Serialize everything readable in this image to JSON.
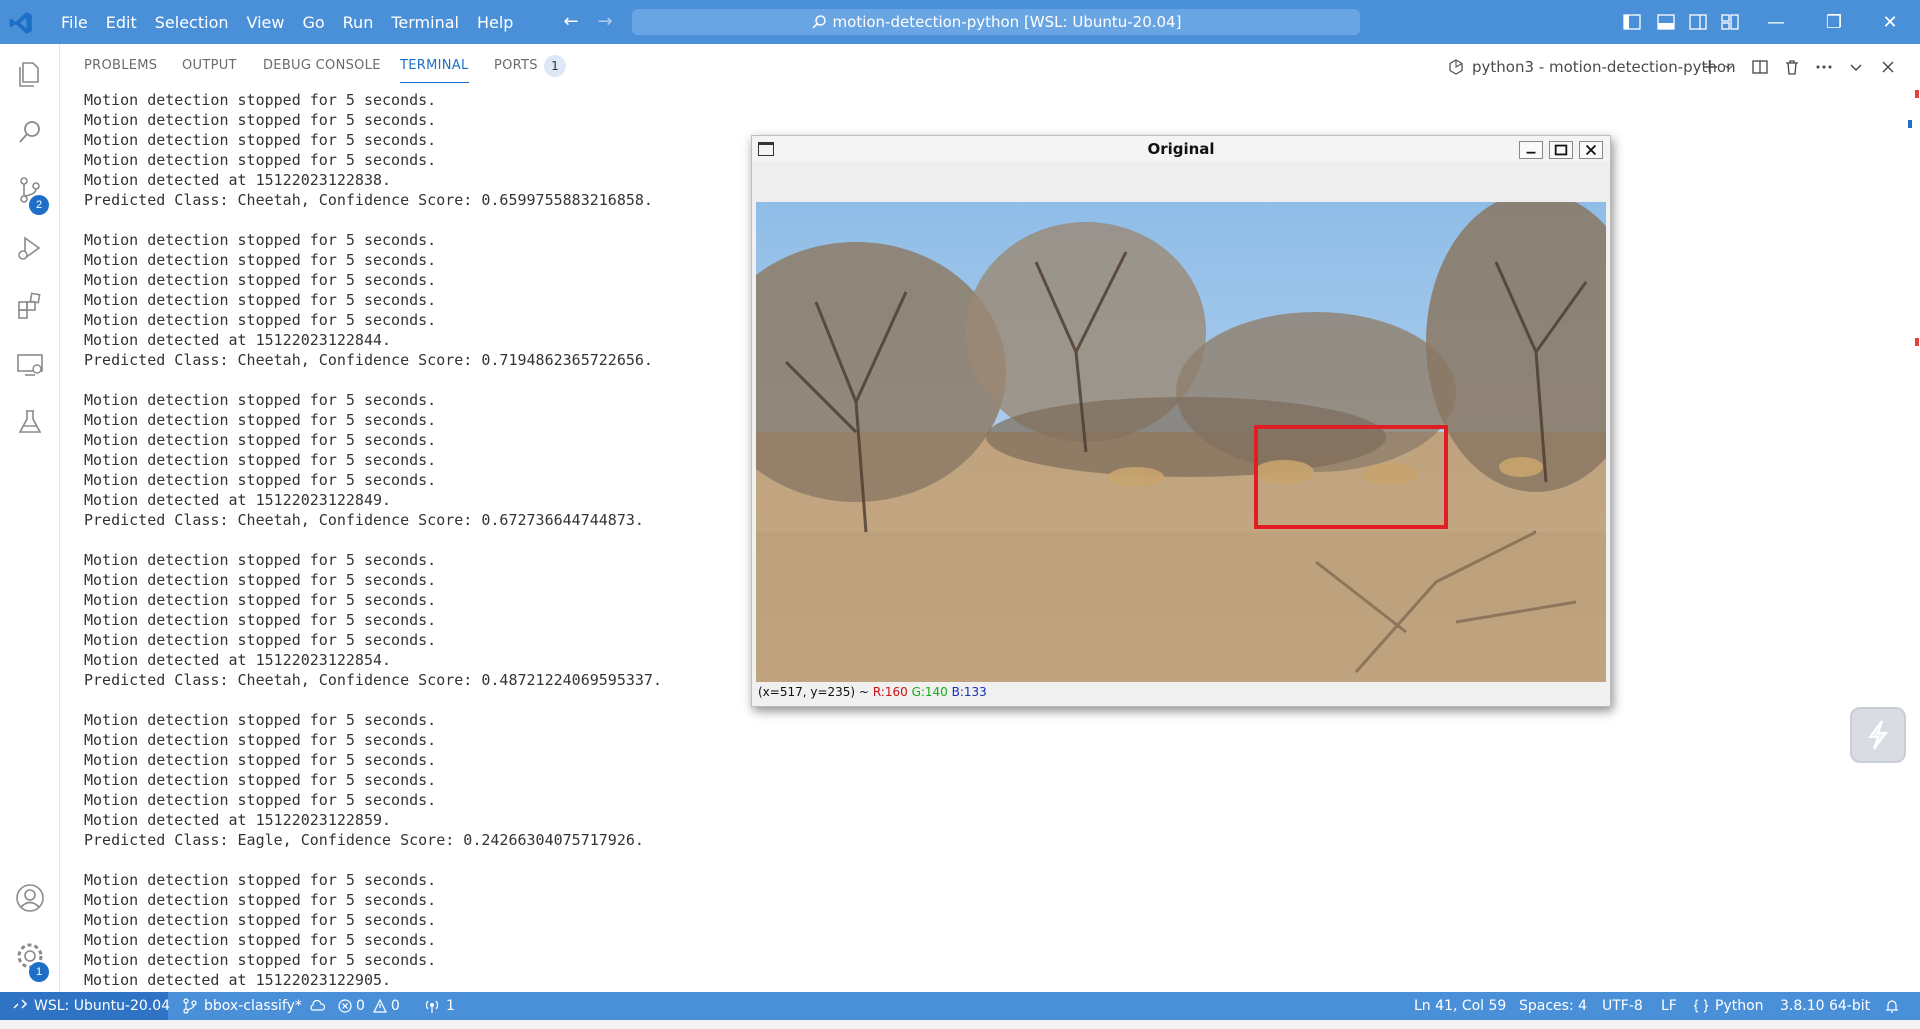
{
  "titlebar": {
    "menu": [
      "File",
      "Edit",
      "Selection",
      "View",
      "Go",
      "Run",
      "Terminal",
      "Help"
    ],
    "search_text": "motion-detection-python [WSL: Ubuntu-20.04]"
  },
  "activitybar": {
    "source_control_badge": "2",
    "settings_badge": "1"
  },
  "panel": {
    "tabs": [
      "PROBLEMS",
      "OUTPUT",
      "DEBUG CONSOLE",
      "TERMINAL",
      "PORTS"
    ],
    "active_tab": "TERMINAL",
    "ports_badge": "1",
    "terminal_name": "python3 - motion-detection-python"
  },
  "terminal": {
    "lines": [
      "Motion detection stopped for 5 seconds.",
      "Motion detection stopped for 5 seconds.",
      "Motion detection stopped for 5 seconds.",
      "Motion detection stopped for 5 seconds.",
      "Motion detected at 15122023122838.",
      "Predicted Class: Cheetah, Confidence Score: 0.6599755883216858.",
      "",
      "Motion detection stopped for 5 seconds.",
      "Motion detection stopped for 5 seconds.",
      "Motion detection stopped for 5 seconds.",
      "Motion detection stopped for 5 seconds.",
      "Motion detection stopped for 5 seconds.",
      "Motion detected at 15122023122844.",
      "Predicted Class: Cheetah, Confidence Score: 0.7194862365722656.",
      "",
      "Motion detection stopped for 5 seconds.",
      "Motion detection stopped for 5 seconds.",
      "Motion detection stopped for 5 seconds.",
      "Motion detection stopped for 5 seconds.",
      "Motion detection stopped for 5 seconds.",
      "Motion detected at 15122023122849.",
      "Predicted Class: Cheetah, Confidence Score: 0.672736644744873.",
      "",
      "Motion detection stopped for 5 seconds.",
      "Motion detection stopped for 5 seconds.",
      "Motion detection stopped for 5 seconds.",
      "Motion detection stopped for 5 seconds.",
      "Motion detection stopped for 5 seconds.",
      "Motion detected at 15122023122854.",
      "Predicted Class: Cheetah, Confidence Score: 0.48721224069595337.",
      "",
      "Motion detection stopped for 5 seconds.",
      "Motion detection stopped for 5 seconds.",
      "Motion detection stopped for 5 seconds.",
      "Motion detection stopped for 5 seconds.",
      "Motion detection stopped for 5 seconds.",
      "Motion detected at 15122023122859.",
      "Predicted Class: Eagle, Confidence Score: 0.24266304075717926.",
      "",
      "Motion detection stopped for 5 seconds.",
      "Motion detection stopped for 5 seconds.",
      "Motion detection stopped for 5 seconds.",
      "Motion detection stopped for 5 seconds.",
      "Motion detection stopped for 5 seconds.",
      "Motion detected at 15122023122905."
    ]
  },
  "image_window": {
    "title": "Original",
    "coords": "(x=517, y=235) ~",
    "r": "R:160",
    "g": "G:140",
    "b": "B:133"
  },
  "statusbar": {
    "remote": "WSL: Ubuntu-20.04",
    "branch": "bbox-classify*",
    "errors": "0",
    "warnings": "0",
    "ports": "1",
    "position": "Ln 41, Col 59",
    "spaces": "Spaces: 4",
    "encoding": "UTF-8",
    "eol": "LF",
    "language": "Python",
    "interpreter": "3.8.10 64-bit"
  },
  "colors": {
    "accent": "#4a90d9",
    "bbox": "#e01e24",
    "r_text": "#d01010",
    "g_text": "#10b010",
    "b_text": "#1030c0"
  }
}
